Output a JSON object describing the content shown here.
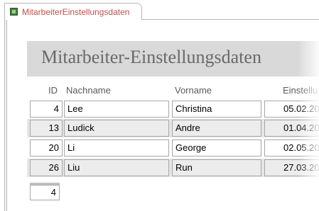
{
  "tab": {
    "label": "MitarbeiterEinstellungsdaten",
    "icon": "form-icon"
  },
  "form": {
    "title": "Mitarbeiter-Einstellungsdaten",
    "columns": {
      "id": "ID",
      "nachname": "Nachname",
      "vorname": "Vorname",
      "einstellung": "Einstellu"
    },
    "rows": [
      {
        "id": "4",
        "nachname": "Lee",
        "vorname": "Christina",
        "datum": "05.02.20"
      },
      {
        "id": "13",
        "nachname": "Ludick",
        "vorname": "Andre",
        "datum": "01.04.20"
      },
      {
        "id": "20",
        "nachname": "Li",
        "vorname": "George",
        "datum": "02.05.20"
      },
      {
        "id": "26",
        "nachname": "Liu",
        "vorname": "Run",
        "datum": "27.03.20"
      }
    ],
    "count": "4"
  },
  "colors": {
    "tab_text": "#c0504d",
    "header_band": "#d9d9d9",
    "row_shade": "#e6e6e6"
  }
}
